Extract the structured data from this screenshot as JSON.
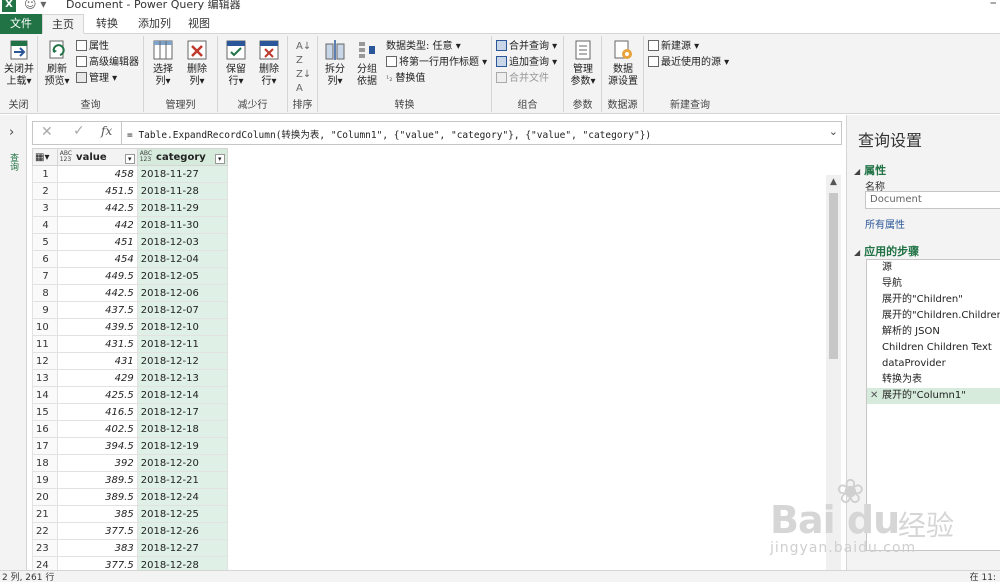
{
  "window": {
    "title": "Document - Power Query 编辑器",
    "app_icon": "excel-icon"
  },
  "tabs": [
    {
      "label": "文件"
    },
    {
      "label": "主页"
    },
    {
      "label": "转换"
    },
    {
      "label": "添加列"
    },
    {
      "label": "视图"
    }
  ],
  "ribbon": {
    "groups": {
      "close": {
        "label": "关闭",
        "btn": "关闭并\n上载▾"
      },
      "query": {
        "label": "查询",
        "refresh": "刷新\n预览▾",
        "properties": "属性",
        "advanced_editor": "高级编辑器",
        "manage": "管理 ▾"
      },
      "manage_cols": {
        "label": "管理列",
        "choose": "选择\n列▾",
        "remove": "删除\n列▾"
      },
      "reduce_rows": {
        "label": "减少行",
        "keep": "保留\n行▾",
        "remove": "删除\n行▾"
      },
      "sort": {
        "label": "排序"
      },
      "transform": {
        "label": "转换",
        "split": "拆分\n列▾",
        "group": "分组\n依据",
        "datatype": "数据类型: 任意 ▾",
        "first_row": "将第一行用作标题 ▾",
        "replace": "替换值"
      },
      "combine": {
        "label": "组合",
        "merge": "合并查询 ▾",
        "append": "追加查询 ▾",
        "combine_files": "合并文件"
      },
      "params": {
        "label": "参数",
        "manage": "管理\n参数▾"
      },
      "datasource": {
        "label": "数据源",
        "settings": "数据\n源设置"
      },
      "newquery": {
        "label": "新建查询",
        "new_source": "新建源 ▾",
        "recent": "最近使用的源 ▾"
      }
    }
  },
  "leftnav": {
    "label": "查询"
  },
  "formula": {
    "text": "= Table.ExpandRecordColumn(转换为表, \"Column1\", {\"value\", \"category\"}, {\"value\", \"category\"})"
  },
  "grid": {
    "columns": [
      {
        "name": "value",
        "type": "ABC\n123"
      },
      {
        "name": "category",
        "type": "ABC\n123"
      }
    ],
    "rows": [
      [
        "1",
        "458",
        "2018-11-27"
      ],
      [
        "2",
        "451.5",
        "2018-11-28"
      ],
      [
        "3",
        "442.5",
        "2018-11-29"
      ],
      [
        "4",
        "442",
        "2018-11-30"
      ],
      [
        "5",
        "451",
        "2018-12-03"
      ],
      [
        "6",
        "454",
        "2018-12-04"
      ],
      [
        "7",
        "449.5",
        "2018-12-05"
      ],
      [
        "8",
        "442.5",
        "2018-12-06"
      ],
      [
        "9",
        "437.5",
        "2018-12-07"
      ],
      [
        "10",
        "439.5",
        "2018-12-10"
      ],
      [
        "11",
        "431.5",
        "2018-12-11"
      ],
      [
        "12",
        "431",
        "2018-12-12"
      ],
      [
        "13",
        "429",
        "2018-12-13"
      ],
      [
        "14",
        "425.5",
        "2018-12-14"
      ],
      [
        "15",
        "416.5",
        "2018-12-17"
      ],
      [
        "16",
        "402.5",
        "2018-12-18"
      ],
      [
        "17",
        "394.5",
        "2018-12-19"
      ],
      [
        "18",
        "392",
        "2018-12-20"
      ],
      [
        "19",
        "389.5",
        "2018-12-21"
      ],
      [
        "20",
        "389.5",
        "2018-12-24"
      ],
      [
        "21",
        "385",
        "2018-12-25"
      ],
      [
        "22",
        "377.5",
        "2018-12-26"
      ],
      [
        "23",
        "383",
        "2018-12-27"
      ],
      [
        "24",
        "377.5",
        "2018-12-28"
      ]
    ]
  },
  "rightpane": {
    "title": "查询设置",
    "properties_section": "属性",
    "name_label": "名称",
    "name_value": "Document",
    "all_properties": "所有属性",
    "steps_section": "应用的步骤",
    "steps": [
      "源",
      "导航",
      "展开的\"Children\"",
      "展开的\"Children.Children\"",
      "解析的 JSON",
      "Children Children Text",
      "dataProvider",
      "转换为表",
      "展开的\"Column1\""
    ],
    "selected_step_index": 8
  },
  "statusbar": {
    "left": "2 列, 261 行",
    "right": "在 11:"
  },
  "watermark": {
    "brand": "Bai du",
    "cn": "经验",
    "url": "jingyan.baidu.com"
  },
  "colors": {
    "accent": "#217346",
    "selected_step": "#d6ebdc",
    "category_column": "#dff0e6"
  }
}
